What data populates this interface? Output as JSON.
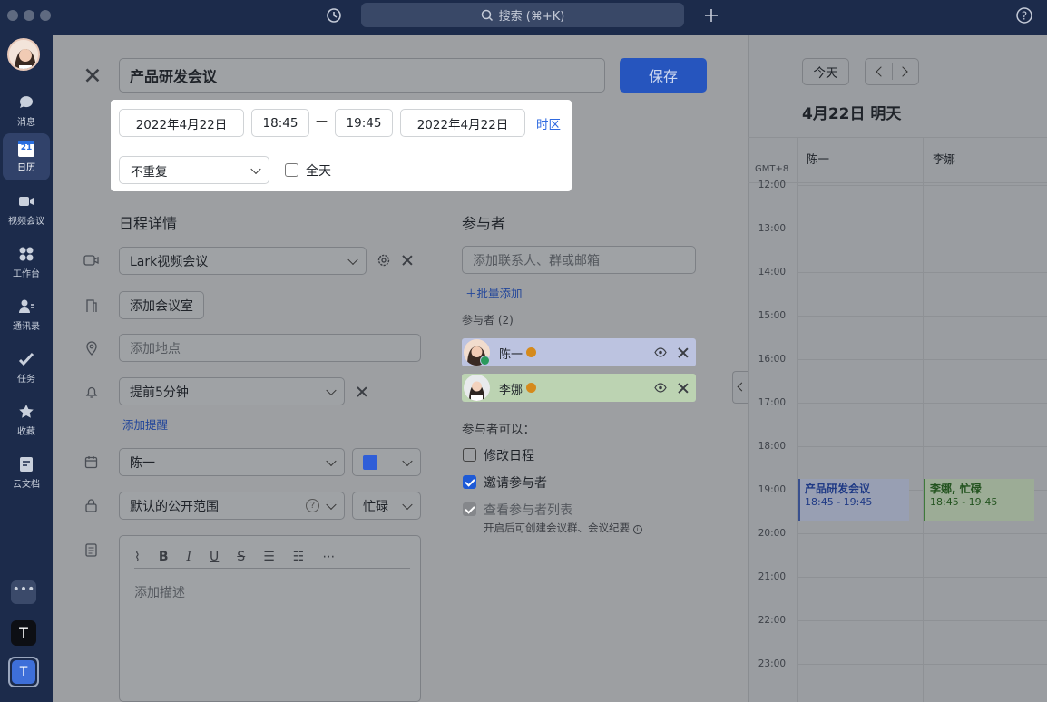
{
  "titlebar": {
    "search_placeholder": "搜索 (⌘+K)"
  },
  "sidebar": {
    "items": [
      {
        "label": "消息",
        "icon": "message-icon"
      },
      {
        "label": "日历",
        "icon": "calendar-icon",
        "date": "21"
      },
      {
        "label": "视频会议",
        "icon": "video-icon"
      },
      {
        "label": "工作台",
        "icon": "workplace-icon"
      },
      {
        "label": "通讯录",
        "icon": "contacts-icon"
      },
      {
        "label": "任务",
        "icon": "task-icon"
      },
      {
        "label": "收藏",
        "icon": "star-icon"
      },
      {
        "label": "云文档",
        "icon": "docs-icon"
      }
    ],
    "tenant1": "T",
    "tenant2": "T"
  },
  "editor": {
    "title_value": "产品研发会议",
    "save_label": "保存",
    "start_date": "2022年4月22日",
    "start_time": "18:45",
    "dash": "—",
    "end_time": "19:45",
    "end_date": "2022年4月22日",
    "timezone_link": "时区",
    "repeat_value": "不重复",
    "allday_label": "全天",
    "details_heading": "日程详情",
    "video_value": "Lark视频会议",
    "room_button": "添加会议室",
    "location_placeholder": "添加地点",
    "reminder_value": "提前5分钟",
    "add_reminder": "添加提醒",
    "calendar_value": "陈一",
    "calendar_color": "#2f5ed8",
    "visibility_value": "默认的公开范围",
    "busy_value": "忙碌",
    "description_placeholder": "添加描述"
  },
  "attendees": {
    "heading": "参与者",
    "input_placeholder": "添加联系人、群或邮箱",
    "bulk_add": "批量添加",
    "count_label": "参与者 (2)",
    "people": [
      {
        "name": "陈一",
        "color": "#bcc3e0"
      },
      {
        "name": "李娜",
        "color": "#bcd3b2"
      }
    ],
    "permissions_heading": "参与者可以：",
    "permissions": [
      {
        "label": "修改日程",
        "checked": false
      },
      {
        "label": "邀请参与者",
        "checked": true
      },
      {
        "label": "查看参与者列表",
        "checked": true
      }
    ],
    "permission_note": "开启后可创建会议群、会议纪要"
  },
  "calendar": {
    "today_button": "今天",
    "date_heading": "4月22日 明天",
    "timezone": "GMT+8",
    "columns": [
      "陈一",
      "李娜"
    ],
    "hours": [
      "12:00",
      "13:00",
      "14:00",
      "15:00",
      "16:00",
      "17:00",
      "18:00",
      "19:00",
      "20:00",
      "21:00",
      "22:00",
      "23:00"
    ],
    "events": [
      {
        "title": "产品研发会议",
        "time": "18:45 - 19:45"
      },
      {
        "title": "李娜, 忙碌",
        "time": "18:45 - 19:45"
      }
    ]
  }
}
